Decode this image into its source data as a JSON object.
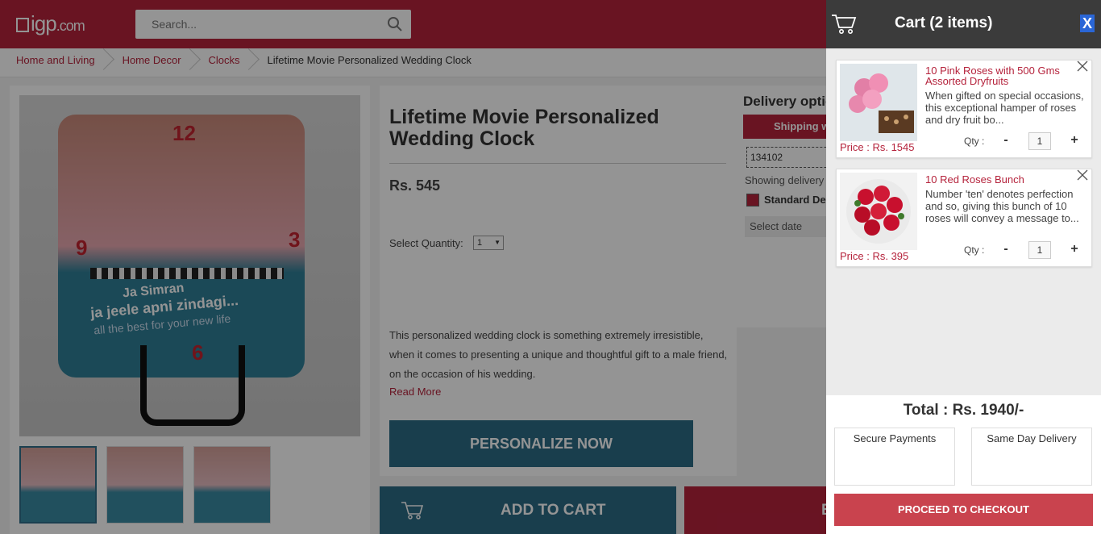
{
  "header": {
    "logo_text": "igp",
    "logo_domain": ".com",
    "search_placeholder": "Search..."
  },
  "breadcrumb": [
    "Home and Living",
    "Home Decor",
    "Clocks",
    "Lifetime Movie Personalized Wedding Clock"
  ],
  "product": {
    "title": "Lifetime Movie Personalized Wedding Clock",
    "price": "Rs. 545",
    "quantity_label": "Select Quantity:",
    "quantity_value": "1",
    "description": "This personalized wedding clock is something extremely irresistible, when it comes to presenting a unique and thoughtful gift to a male friend, on the occasion of his wedding.",
    "read_more": "Read More",
    "personalize_label": "PERSONALIZE NOW",
    "add_to_cart_label": "ADD TO CART",
    "buy_now_label": "B",
    "clock_numbers": [
      "12",
      "9",
      "3",
      "6"
    ],
    "clock_text_line1": "Ja Simran",
    "clock_text_line2": "ja jeele apni zindagi...",
    "clock_text_line3": "all the best for your new life"
  },
  "delivery": {
    "title": "Delivery optio",
    "shipping_label": "Shipping w",
    "pincode": "134102",
    "showing_text": "Showing delivery",
    "standard_label": "Standard De",
    "select_date": "Select date"
  },
  "cart": {
    "title": "Cart (2 items)",
    "close_label": "X",
    "items": [
      {
        "name": "10 Pink Roses with 500 Gms Assorted Dryfruits",
        "description": "When gifted on special occasions, this exceptional hamper of roses and dry fruit bo...",
        "price": "Price : Rs. 1545",
        "qty_label": "Qty :",
        "qty": "1",
        "minus": "-",
        "plus": "+"
      },
      {
        "name": "10 Red Roses Bunch",
        "description": "Number 'ten' denotes perfection and so, giving this bunch of 10 roses will convey a message to...",
        "price": "Price : Rs. 395",
        "qty_label": "Qty :",
        "qty": "1",
        "minus": "-",
        "plus": "+"
      }
    ],
    "total": "Total : Rs. 1940/-",
    "feature_1": "Secure Payments",
    "feature_2": "Same Day Delivery",
    "checkout_label": "PROCEED TO CHECKOUT"
  },
  "colors": {
    "brand_red": "#b5233c",
    "brand_blue": "#2b6b86",
    "cart_header": "#3b3b3b"
  }
}
